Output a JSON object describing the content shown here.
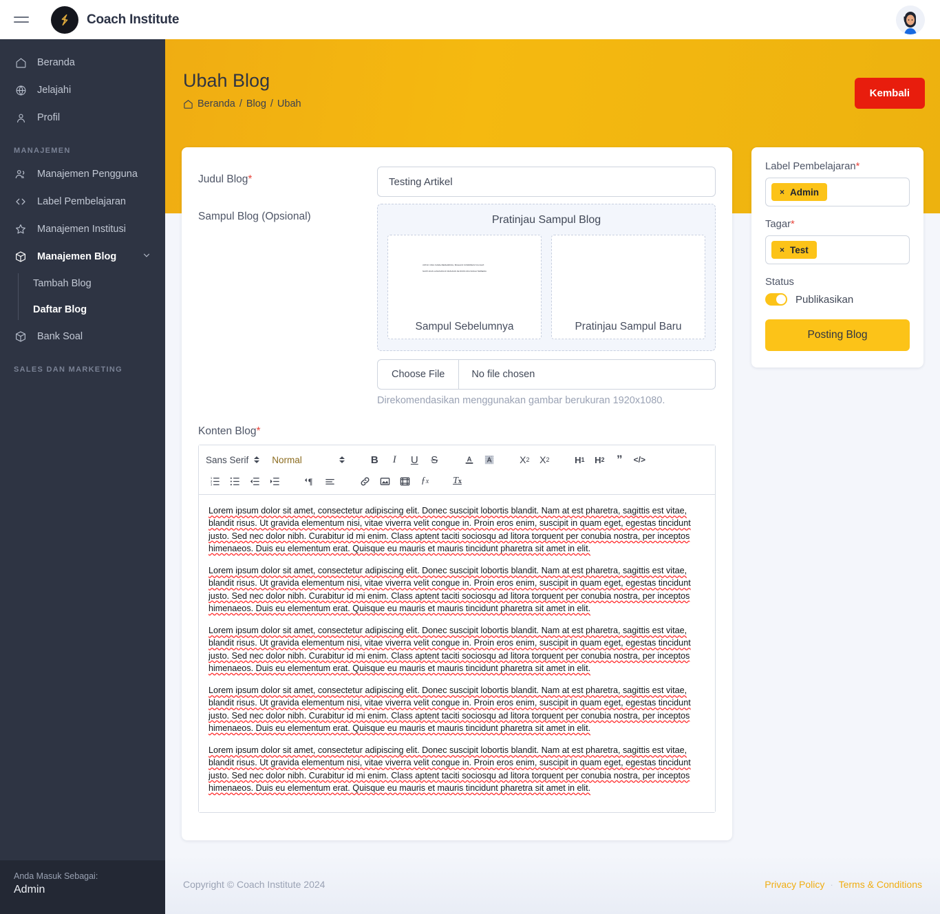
{
  "app": {
    "brand": "Coach Institute",
    "menu_icon": "hamburger-icon",
    "avatar_icon": "user-avatar"
  },
  "sidebar": {
    "items": [
      {
        "label": "Beranda",
        "icon": "home-icon"
      },
      {
        "label": "Jelajahi",
        "icon": "globe-icon"
      },
      {
        "label": "Profil",
        "icon": "user-icon"
      }
    ],
    "section_management": "MANAJEMEN",
    "management_items": [
      {
        "label": "Manajemen Pengguna",
        "icon": "users-icon"
      },
      {
        "label": "Label Pembelajaran",
        "icon": "code-icon"
      },
      {
        "label": "Manajemen Institusi",
        "icon": "star-icon"
      },
      {
        "label": "Manajemen Blog",
        "icon": "box-icon"
      }
    ],
    "blog_children": [
      {
        "label": "Tambah Blog"
      },
      {
        "label": "Daftar Blog"
      }
    ],
    "bank_soal": {
      "label": "Bank Soal",
      "icon": "box-icon"
    },
    "section_sales": "SALES DAN MARKETING",
    "user": {
      "caption": "Anda Masuk Sebagai:",
      "name": "Admin"
    }
  },
  "header": {
    "title": "Ubah Blog",
    "breadcrumb": [
      {
        "label": "Beranda",
        "icon": "home-icon"
      },
      {
        "label": "Blog"
      },
      {
        "label": "Ubah"
      }
    ],
    "separator": "/",
    "back_button": "Kembali"
  },
  "form": {
    "title_label": "Judul Blog",
    "title_value": "Testing Artikel",
    "cover_label": "Sampul Blog (Opsional)",
    "preview_title": "Pratinjau Sampul Blog",
    "preview_old_caption": "Sampul Sebelumnya",
    "preview_new_caption": "Pratinjau Sampul Baru",
    "cover_art_line1": "UNTUK YANG SUDAH BERGABUNG, BOLEH DI KONFIRMASI VIA CHAT.",
    "cover_art_line2": "NANTI AKAN LANGSUNG DI MASUKAN KE ROOM JIKA SUDAH TERSEDIA",
    "file_button": "Choose File",
    "file_status": "No file chosen",
    "file_hint": "Direkomendasikan menggunakan gambar berukuran 1920x1080.",
    "content_label": "Konten Blog",
    "required_mark": "*"
  },
  "editor": {
    "font_family": "Sans Serif",
    "font_size": "Normal",
    "tools_row1": [
      {
        "name": "bold-icon",
        "glyph": "B"
      },
      {
        "name": "italic-icon",
        "glyph": "I"
      },
      {
        "name": "underline-icon",
        "glyph": "U"
      },
      {
        "name": "strikethrough-icon",
        "glyph": "S"
      },
      {
        "name": "text-color-icon",
        "glyph": "A"
      },
      {
        "name": "highlight-color-icon",
        "glyph": "A"
      },
      {
        "name": "subscript-icon",
        "glyph": "x2"
      },
      {
        "name": "superscript-icon",
        "glyph": "x2"
      },
      {
        "name": "heading-1-icon",
        "glyph": "H1"
      },
      {
        "name": "heading-2-icon",
        "glyph": "H2"
      },
      {
        "name": "blockquote-icon",
        "glyph": "\""
      },
      {
        "name": "code-block-icon",
        "glyph": "</>"
      }
    ],
    "tools_row2": [
      {
        "name": "ordered-list-icon"
      },
      {
        "name": "bullet-list-icon"
      },
      {
        "name": "outdent-icon"
      },
      {
        "name": "indent-icon"
      },
      {
        "name": "text-direction-icon"
      },
      {
        "name": "align-icon"
      },
      {
        "name": "link-icon"
      },
      {
        "name": "image-icon"
      },
      {
        "name": "video-icon"
      },
      {
        "name": "formula-icon"
      },
      {
        "name": "clear-format-icon"
      }
    ],
    "paragraphs": [
      "Lorem ipsum dolor sit amet, consectetur adipiscing elit. Donec suscipit lobortis blandit. Nam at est pharetra, sagittis est vitae, blandit risus. Ut gravida elementum nisi, vitae viverra velit congue in. Proin eros enim, suscipit in quam eget, egestas tincidunt justo. Sed nec dolor nibh. Curabitur id mi enim. Class aptent taciti sociosqu ad litora torquent per conubia nostra, per inceptos himenaeos. Duis eu elementum erat. Quisque eu mauris et mauris tincidunt pharetra sit amet in elit.",
      "Lorem ipsum dolor sit amet, consectetur adipiscing elit. Donec suscipit lobortis blandit. Nam at est pharetra, sagittis est vitae, blandit risus. Ut gravida elementum nisi, vitae viverra velit congue in. Proin eros enim, suscipit in quam eget, egestas tincidunt justo. Sed nec dolor nibh. Curabitur id mi enim. Class aptent taciti sociosqu ad litora torquent per conubia nostra, per inceptos himenaeos. Duis eu elementum erat. Quisque eu mauris et mauris tincidunt pharetra sit amet in elit.",
      "Lorem ipsum dolor sit amet, consectetur adipiscing elit. Donec suscipit lobortis blandit. Nam at est pharetra, sagittis est vitae, blandit risus. Ut gravida elementum nisi, vitae viverra velit congue in. Proin eros enim, suscipit in quam eget, egestas tincidunt justo. Sed nec dolor nibh. Curabitur id mi enim. Class aptent taciti sociosqu ad litora torquent per conubia nostra, per inceptos himenaeos. Duis eu elementum erat. Quisque eu mauris et mauris tincidunt pharetra sit amet in elit.",
      "Lorem ipsum dolor sit amet, consectetur adipiscing elit. Donec suscipit lobortis blandit. Nam at est pharetra, sagittis est vitae, blandit risus. Ut gravida elementum nisi, vitae viverra velit congue in. Proin eros enim, suscipit in quam eget, egestas tincidunt justo. Sed nec dolor nibh. Curabitur id mi enim. Class aptent taciti sociosqu ad litora torquent per conubia nostra, per inceptos himenaeos. Duis eu elementum erat. Quisque eu mauris et mauris tincidunt pharetra sit amet in elit.",
      "Lorem ipsum dolor sit amet, consectetur adipiscing elit. Donec suscipit lobortis blandit. Nam at est pharetra, sagittis est vitae, blandit risus. Ut gravida elementum nisi, vitae viverra velit congue in. Proin eros enim, suscipit in quam eget, egestas tincidunt justo. Sed nec dolor nibh. Curabitur id mi enim. Class aptent taciti sociosqu ad litora torquent per conubia nostra, per inceptos himenaeos. Duis eu elementum erat. Quisque eu mauris et mauris tincidunt pharetra sit amet in elit."
    ]
  },
  "side_panel": {
    "label_pembelajaran": "Label Pembelajaran",
    "label_chip": "Admin",
    "tagar_label": "Tagar",
    "tagar_chip": "Test",
    "status_label": "Status",
    "status_toggle_text": "Publikasikan",
    "status_toggle_on": true,
    "post_button": "Posting Blog",
    "chip_remove": "×",
    "required_mark": "*"
  },
  "footer": {
    "copyright": "Copyright © Coach Institute 2024",
    "privacy": "Privacy Policy",
    "separator": "·",
    "terms": "Terms & Conditions"
  },
  "colors": {
    "accent_yellow": "#f0ad12",
    "chip_yellow": "#fcc318",
    "danger_red": "#e81d0d",
    "sidebar_dark": "#2e3443",
    "page_bg": "#f4f6fb"
  }
}
